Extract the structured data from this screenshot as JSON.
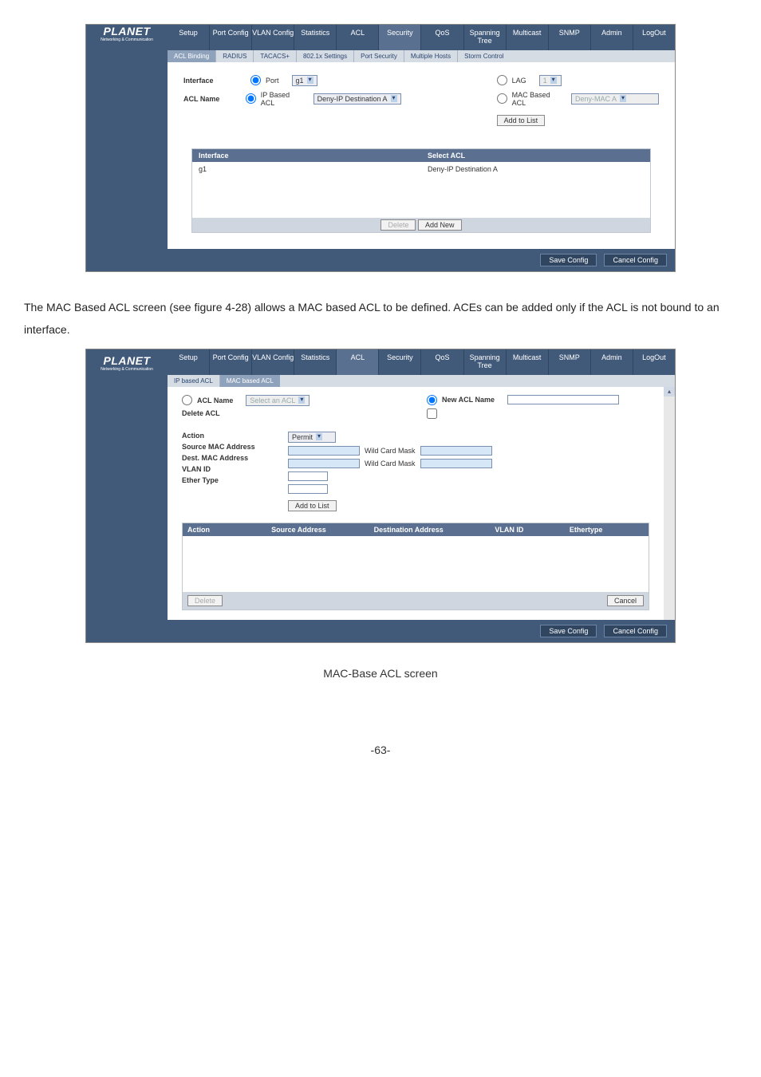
{
  "logo": {
    "name": "PLANET",
    "sub": "Networking & Communication"
  },
  "nav": [
    "Setup",
    "Port Config",
    "VLAN Config",
    "Statistics",
    "ACL",
    "Security",
    "QoS",
    "Spanning Tree",
    "Multicast",
    "SNMP",
    "Admin",
    "LogOut"
  ],
  "subnav1": [
    "ACL Binding",
    "RADIUS",
    "TACACS+",
    "802.1x Settings",
    "Port Security",
    "Multiple Hosts",
    "Storm Control"
  ],
  "shot1": {
    "labels": {
      "interface": "Interface",
      "aclname": "ACL Name"
    },
    "radios": {
      "port": "Port",
      "lag": "LAG",
      "ipacl": "IP Based ACL",
      "macacl": "MAC Based ACL"
    },
    "selects": {
      "port": "g1",
      "lag": "1",
      "ipacl": "Deny-IP Destination A",
      "macacl": "Deny-MAC A"
    },
    "button_addtolist": "Add to List",
    "grid": {
      "h1": "Interface",
      "h2": "Select ACL",
      "r1a": "g1",
      "r1b": "Deny-IP Destination A"
    },
    "btns": {
      "delete": "Delete",
      "addnew": "Add New"
    }
  },
  "footbtns": {
    "save": "Save Config",
    "cancel": "Cancel Config"
  },
  "body_text": "The MAC Based ACL screen (see figure 4-28) allows a MAC based ACL to be defined. ACEs can be added only if the ACL is not bound to an interface.",
  "subnav2": [
    "IP based ACL",
    "MAC based ACL"
  ],
  "shot2": {
    "left": {
      "aclname": "ACL Name",
      "aclname_sel": "Select an ACL",
      "delete": "Delete ACL"
    },
    "right": {
      "newacl": "New ACL Name"
    },
    "fields": {
      "action": "Action",
      "action_val": "Permit",
      "srcmac": "Source MAC Address",
      "dstmac": "Dest. MAC Address",
      "vlanid": "VLAN ID",
      "ether": "Ether Type",
      "wild": "Wild Card Mask"
    },
    "button_addtolist": "Add to List",
    "grid": {
      "c1": "Action",
      "c2": "Source Address",
      "c3": "Destination Address",
      "c4": "VLAN ID",
      "c5": "Ethertype"
    },
    "btns": {
      "delete": "Delete",
      "cancel": "Cancel"
    }
  },
  "caption2": "MAC-Base ACL screen",
  "pagenum": "-63-"
}
